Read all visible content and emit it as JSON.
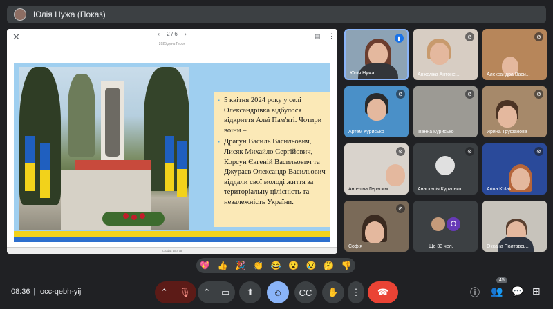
{
  "topbar": {
    "title": "Юлія Нужа (Показ)"
  },
  "presentation": {
    "close_icon": "✕",
    "prev": "‹",
    "page": "2 / 6",
    "next": "›",
    "subtitle": "2025 день Героя",
    "status": "СЛАЙД 10 З 18",
    "slide_text": [
      "5 квітня 2024 року у селі Олександрівка відбулося відкриття Алеї Пам'яті. Чотири воїни –",
      "Драгун Василь Васильович, Лисяк Михайло Сергійович, Корсун Євгеній Васильович та Джураєв Олександр Васильович віддали свої молоді життя за територіальну цілісність та незалежність України."
    ]
  },
  "participants": [
    {
      "name": "Юлія Нужа"
    },
    {
      "name": "Анжеліка Антоне..."
    },
    {
      "name": "Александра Васи..."
    },
    {
      "name": "Артем Курисько"
    },
    {
      "name": "Іванна Курисько"
    },
    {
      "name": "Ирина Труфанова"
    },
    {
      "name": "Ангеліна Герасим..."
    },
    {
      "name": "Анастасія Курисько"
    },
    {
      "name": "Arina Kulak"
    },
    {
      "name": "Софія"
    },
    {
      "name": "Ще 33 чел.",
      "avatar_letter": "O"
    },
    {
      "name": "Оксана Полтавсь..."
    }
  ],
  "reactions": [
    "💖",
    "👍",
    "🎉",
    "👏",
    "😂",
    "😮",
    "😢",
    "🤔",
    "👎"
  ],
  "bottom": {
    "time": "08:36",
    "separator": "|",
    "meeting_code": "occ-qebh-yij",
    "participant_count": "45"
  },
  "colors": {
    "bg": "#202124",
    "end_call": "#ea4335",
    "active": "#8ab4f8",
    "mic_off": "#5f1a1a"
  }
}
